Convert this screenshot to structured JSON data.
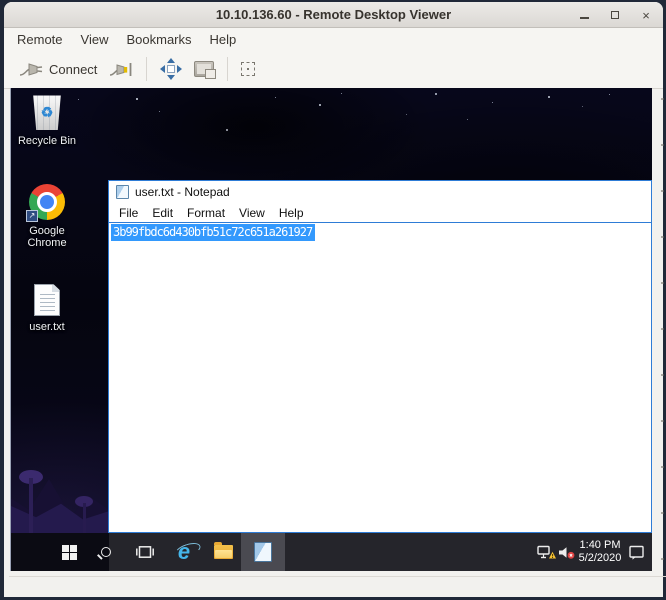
{
  "app": {
    "title": "10.10.136.60 - Remote Desktop Viewer",
    "menu": [
      "Remote",
      "View",
      "Bookmarks",
      "Help"
    ],
    "toolbar": {
      "connect_label": "Connect"
    },
    "controls": {
      "close": "×"
    },
    "icons": {
      "recycle_glyph": "♻",
      "shortcut_arrow": "➜",
      "ie_letter": "e"
    }
  },
  "remote": {
    "desktop_icons": [
      {
        "label": "Recycle Bin"
      },
      {
        "label": "Google Chrome"
      },
      {
        "label": "user.txt"
      }
    ],
    "notepad": {
      "title": "user.txt - Notepad",
      "menu": [
        "File",
        "Edit",
        "Format",
        "View",
        "Help"
      ],
      "text": "3b99fbdc6d430bfb51c72c651a261927"
    },
    "taskbar": {
      "clock": {
        "time": "1:40 PM",
        "date": "5/2/2020"
      }
    },
    "colors": {
      "selection_bg": "#3399fd",
      "notepad_border": "#2e7cd6",
      "taskbar_bg": "#25252b",
      "taskbar_active_bg": "#4a4a51",
      "warning_yellow": "#f8c435",
      "mute_red": "#e04343"
    }
  }
}
